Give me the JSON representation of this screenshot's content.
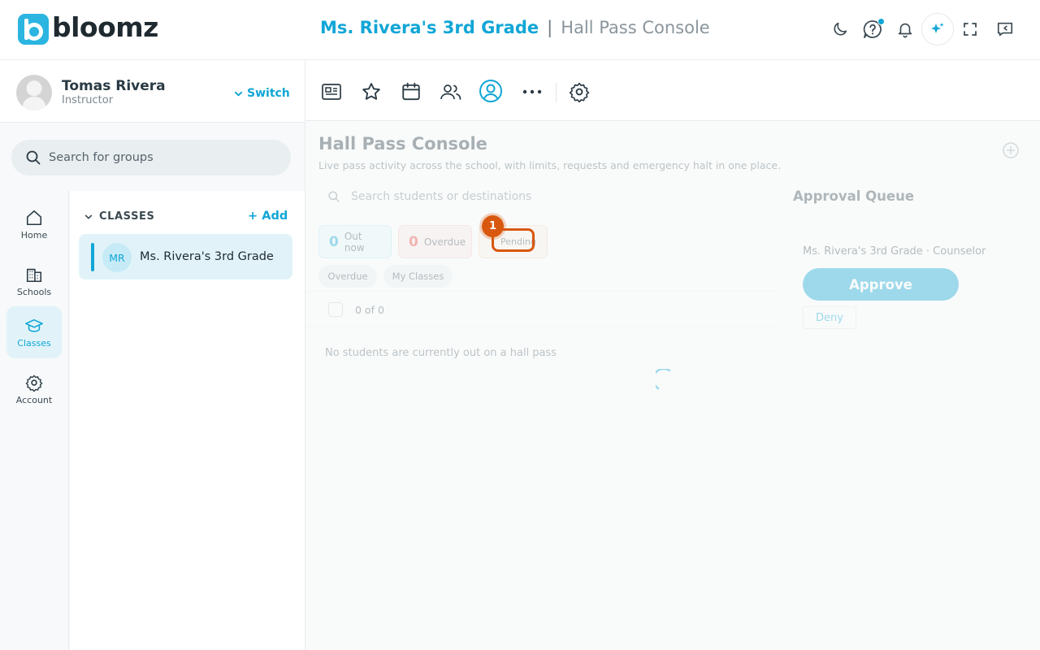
{
  "brand": {
    "name": "bloomz",
    "mark": "b"
  },
  "header": {
    "class_title": "Ms. Rivera's 3rd Grade",
    "separator": "|",
    "page_title": "Hall Pass Console",
    "icons": [
      "moon-icon",
      "help-icon",
      "bell-icon",
      "sparkle-icon",
      "fullscreen-icon",
      "chat-icon"
    ]
  },
  "user": {
    "name": "Tomas Rivera",
    "role": "Instructor",
    "switch_label": "Switch"
  },
  "group_search": {
    "placeholder": "Search for groups"
  },
  "nav": [
    {
      "label": "Home",
      "icon": "home-icon",
      "active": false
    },
    {
      "label": "Schools",
      "icon": "building-icon",
      "active": false
    },
    {
      "label": "Classes",
      "icon": "graduation-cap-icon",
      "active": true
    },
    {
      "label": "Account",
      "icon": "gear-icon",
      "active": false
    }
  ],
  "classes": {
    "header": "CLASSES",
    "add_label": "Add",
    "items": [
      {
        "initials": "MR",
        "name": "Ms. Rivera's 3rd Grade"
      }
    ]
  },
  "toolbar": {
    "icons": [
      "newsfeed-icon",
      "star-icon",
      "calendar-icon",
      "people-icon",
      "profile-icon",
      "more-icon",
      "settings-icon"
    ],
    "active_icon": "profile-icon"
  },
  "console": {
    "title": "Hall Pass Console",
    "subtitle": "Live pass activity across the school, with limits, requests and emergency halt in one place.",
    "search_placeholder": "Search students or destinations",
    "stats": [
      {
        "key": "out",
        "value": "0",
        "label": "Out now"
      },
      {
        "key": "overdue",
        "value": "0",
        "label": "Overdue"
      },
      {
        "key": "pending",
        "value": "",
        "label": "Pending"
      }
    ],
    "filters": [
      "Overdue",
      "My Classes"
    ],
    "count_text": "0 of 0",
    "empty_text": "No students are currently out on a hall pass"
  },
  "approval_queue": {
    "title": "Approval Queue",
    "item": "Ms. Rivera's 3rd Grade · Counselor",
    "approve_label": "Approve",
    "deny_label": "Deny"
  },
  "tutorial": {
    "step": "1"
  },
  "colors": {
    "accent": "#11a6d6",
    "danger": "#e4473d",
    "highlight": "#d9580f"
  }
}
